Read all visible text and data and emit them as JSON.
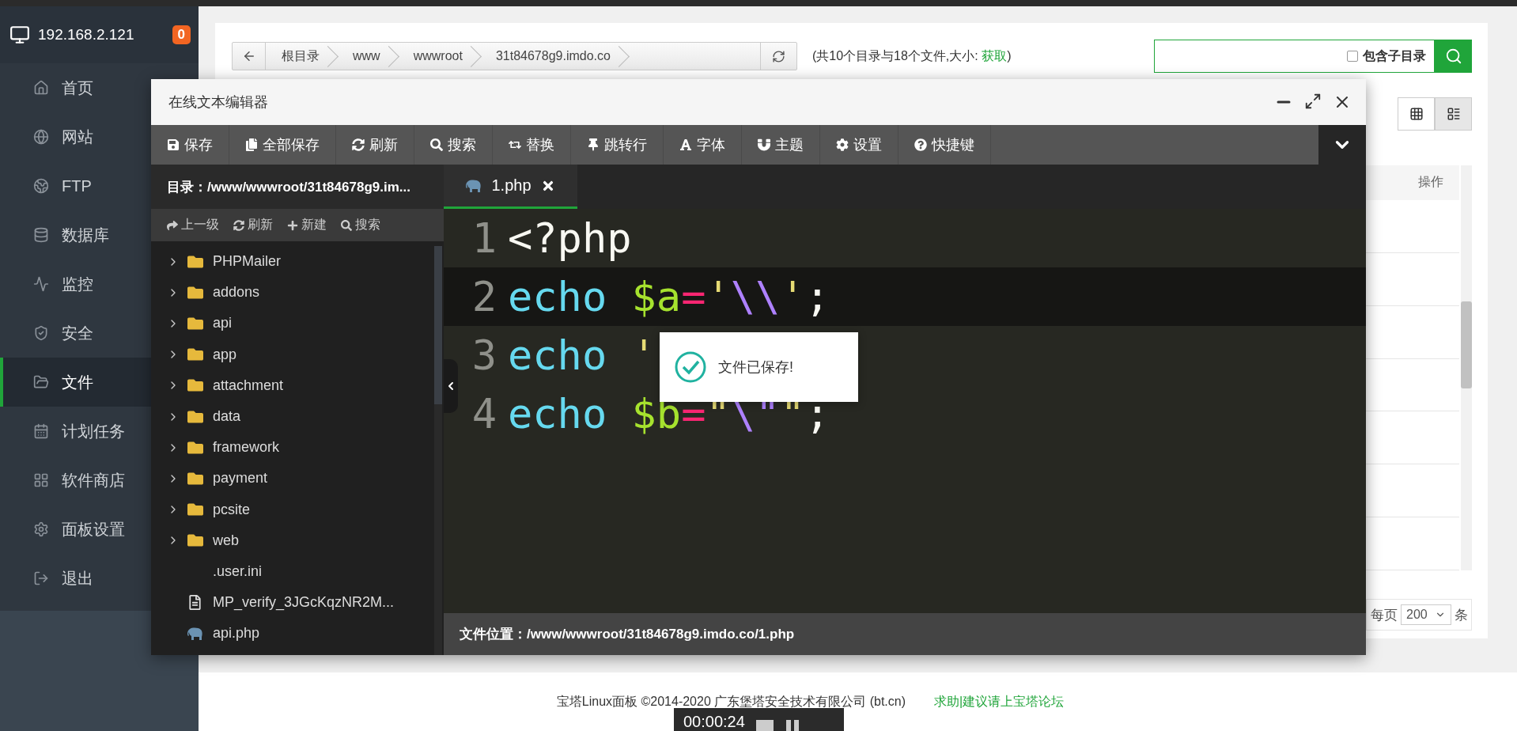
{
  "sidebar": {
    "host": "192.168.2.121",
    "badge": "0",
    "items": [
      {
        "label": "首页",
        "selected": false
      },
      {
        "label": "网站",
        "selected": false
      },
      {
        "label": "FTP",
        "selected": false
      },
      {
        "label": "数据库",
        "selected": false
      },
      {
        "label": "监控",
        "selected": false
      },
      {
        "label": "安全",
        "selected": false
      },
      {
        "label": "文件",
        "selected": true
      },
      {
        "label": "计划任务",
        "selected": false
      },
      {
        "label": "软件商店",
        "selected": false
      },
      {
        "label": "面板设置",
        "selected": false
      },
      {
        "label": "退出",
        "selected": false
      }
    ]
  },
  "files": {
    "breadcrumb": [
      "根目录",
      "www",
      "wwwroot",
      "31t84678g9.imdo.co"
    ],
    "summary": {
      "prefix": "(共10个目录与18个文件,大小: ",
      "link": "获取",
      "suffix": ")"
    },
    "search": {
      "checkbox_label": "包含子目录",
      "checked": false
    },
    "view_modes": [
      {
        "selected": false
      },
      {
        "selected": true
      }
    ],
    "table": {
      "action_header": "操作"
    },
    "pagination": {
      "label": "每页",
      "per_page": "200",
      "unit": "条"
    }
  },
  "footer": {
    "copyright": "宝塔Linux面板 ©2014-2020 广东堡塔安全技术有限公司 (bt.cn)",
    "link": "求助|建议请上宝塔论坛"
  },
  "editor": {
    "title": "在线文本编辑器",
    "toolbar": [
      "保存",
      "全部保存",
      "刷新",
      "搜索",
      "替换",
      "跳转行",
      "字体",
      "主题",
      "设置",
      "快捷键"
    ],
    "directory": "目录：/www/wwwroot/31t84678g9.im...",
    "tree_actions": [
      "上一级",
      "刷新",
      "新建",
      "搜索"
    ],
    "tree": [
      {
        "name": "PHPMailer",
        "kind": "folder"
      },
      {
        "name": "addons",
        "kind": "folder"
      },
      {
        "name": "api",
        "kind": "folder"
      },
      {
        "name": "app",
        "kind": "folder"
      },
      {
        "name": "attachment",
        "kind": "folder"
      },
      {
        "name": "data",
        "kind": "folder"
      },
      {
        "name": "framework",
        "kind": "folder"
      },
      {
        "name": "payment",
        "kind": "folder"
      },
      {
        "name": "pcsite",
        "kind": "folder"
      },
      {
        "name": "web",
        "kind": "folder"
      },
      {
        "name": ".user.ini",
        "kind": "plain"
      },
      {
        "name": "MP_verify_3JGcKqzNR2M...",
        "kind": "text"
      },
      {
        "name": "api.php",
        "kind": "php"
      }
    ],
    "tabs": [
      {
        "label": "1.php",
        "selected": true
      }
    ],
    "lines": [
      {
        "number": "1",
        "active": false,
        "tokens": [
          {
            "kind": "tag",
            "text": "<?php"
          }
        ]
      },
      {
        "number": "2",
        "active": true,
        "tokens": [
          {
            "kind": "keyword",
            "text": "echo "
          },
          {
            "kind": "variable",
            "text": "$a"
          },
          {
            "kind": "operator",
            "text": "="
          },
          {
            "kind": "string",
            "text": "'"
          },
          {
            "kind": "escape",
            "text": "\\\\"
          },
          {
            "kind": "string",
            "text": "'"
          },
          {
            "kind": "punct",
            "text": ";"
          }
        ]
      },
      {
        "number": "3",
        "active": false,
        "tokens": [
          {
            "kind": "keyword",
            "text": "echo "
          },
          {
            "kind": "string",
            "text": "'"
          }
        ]
      },
      {
        "number": "4",
        "active": false,
        "tokens": [
          {
            "kind": "keyword",
            "text": "echo "
          },
          {
            "kind": "variable",
            "text": "$b"
          },
          {
            "kind": "operator",
            "text": "="
          },
          {
            "kind": "string",
            "text": "\""
          },
          {
            "kind": "escape",
            "text": "\\\""
          },
          {
            "kind": "string",
            "text": "\""
          },
          {
            "kind": "punct",
            "text": ";"
          }
        ]
      }
    ],
    "status": "文件位置：/www/wwwroot/31t84678g9.imdo.co/1.php"
  },
  "toast": {
    "message": "文件已保存!"
  },
  "recorder": {
    "time": "00:00:24"
  }
}
